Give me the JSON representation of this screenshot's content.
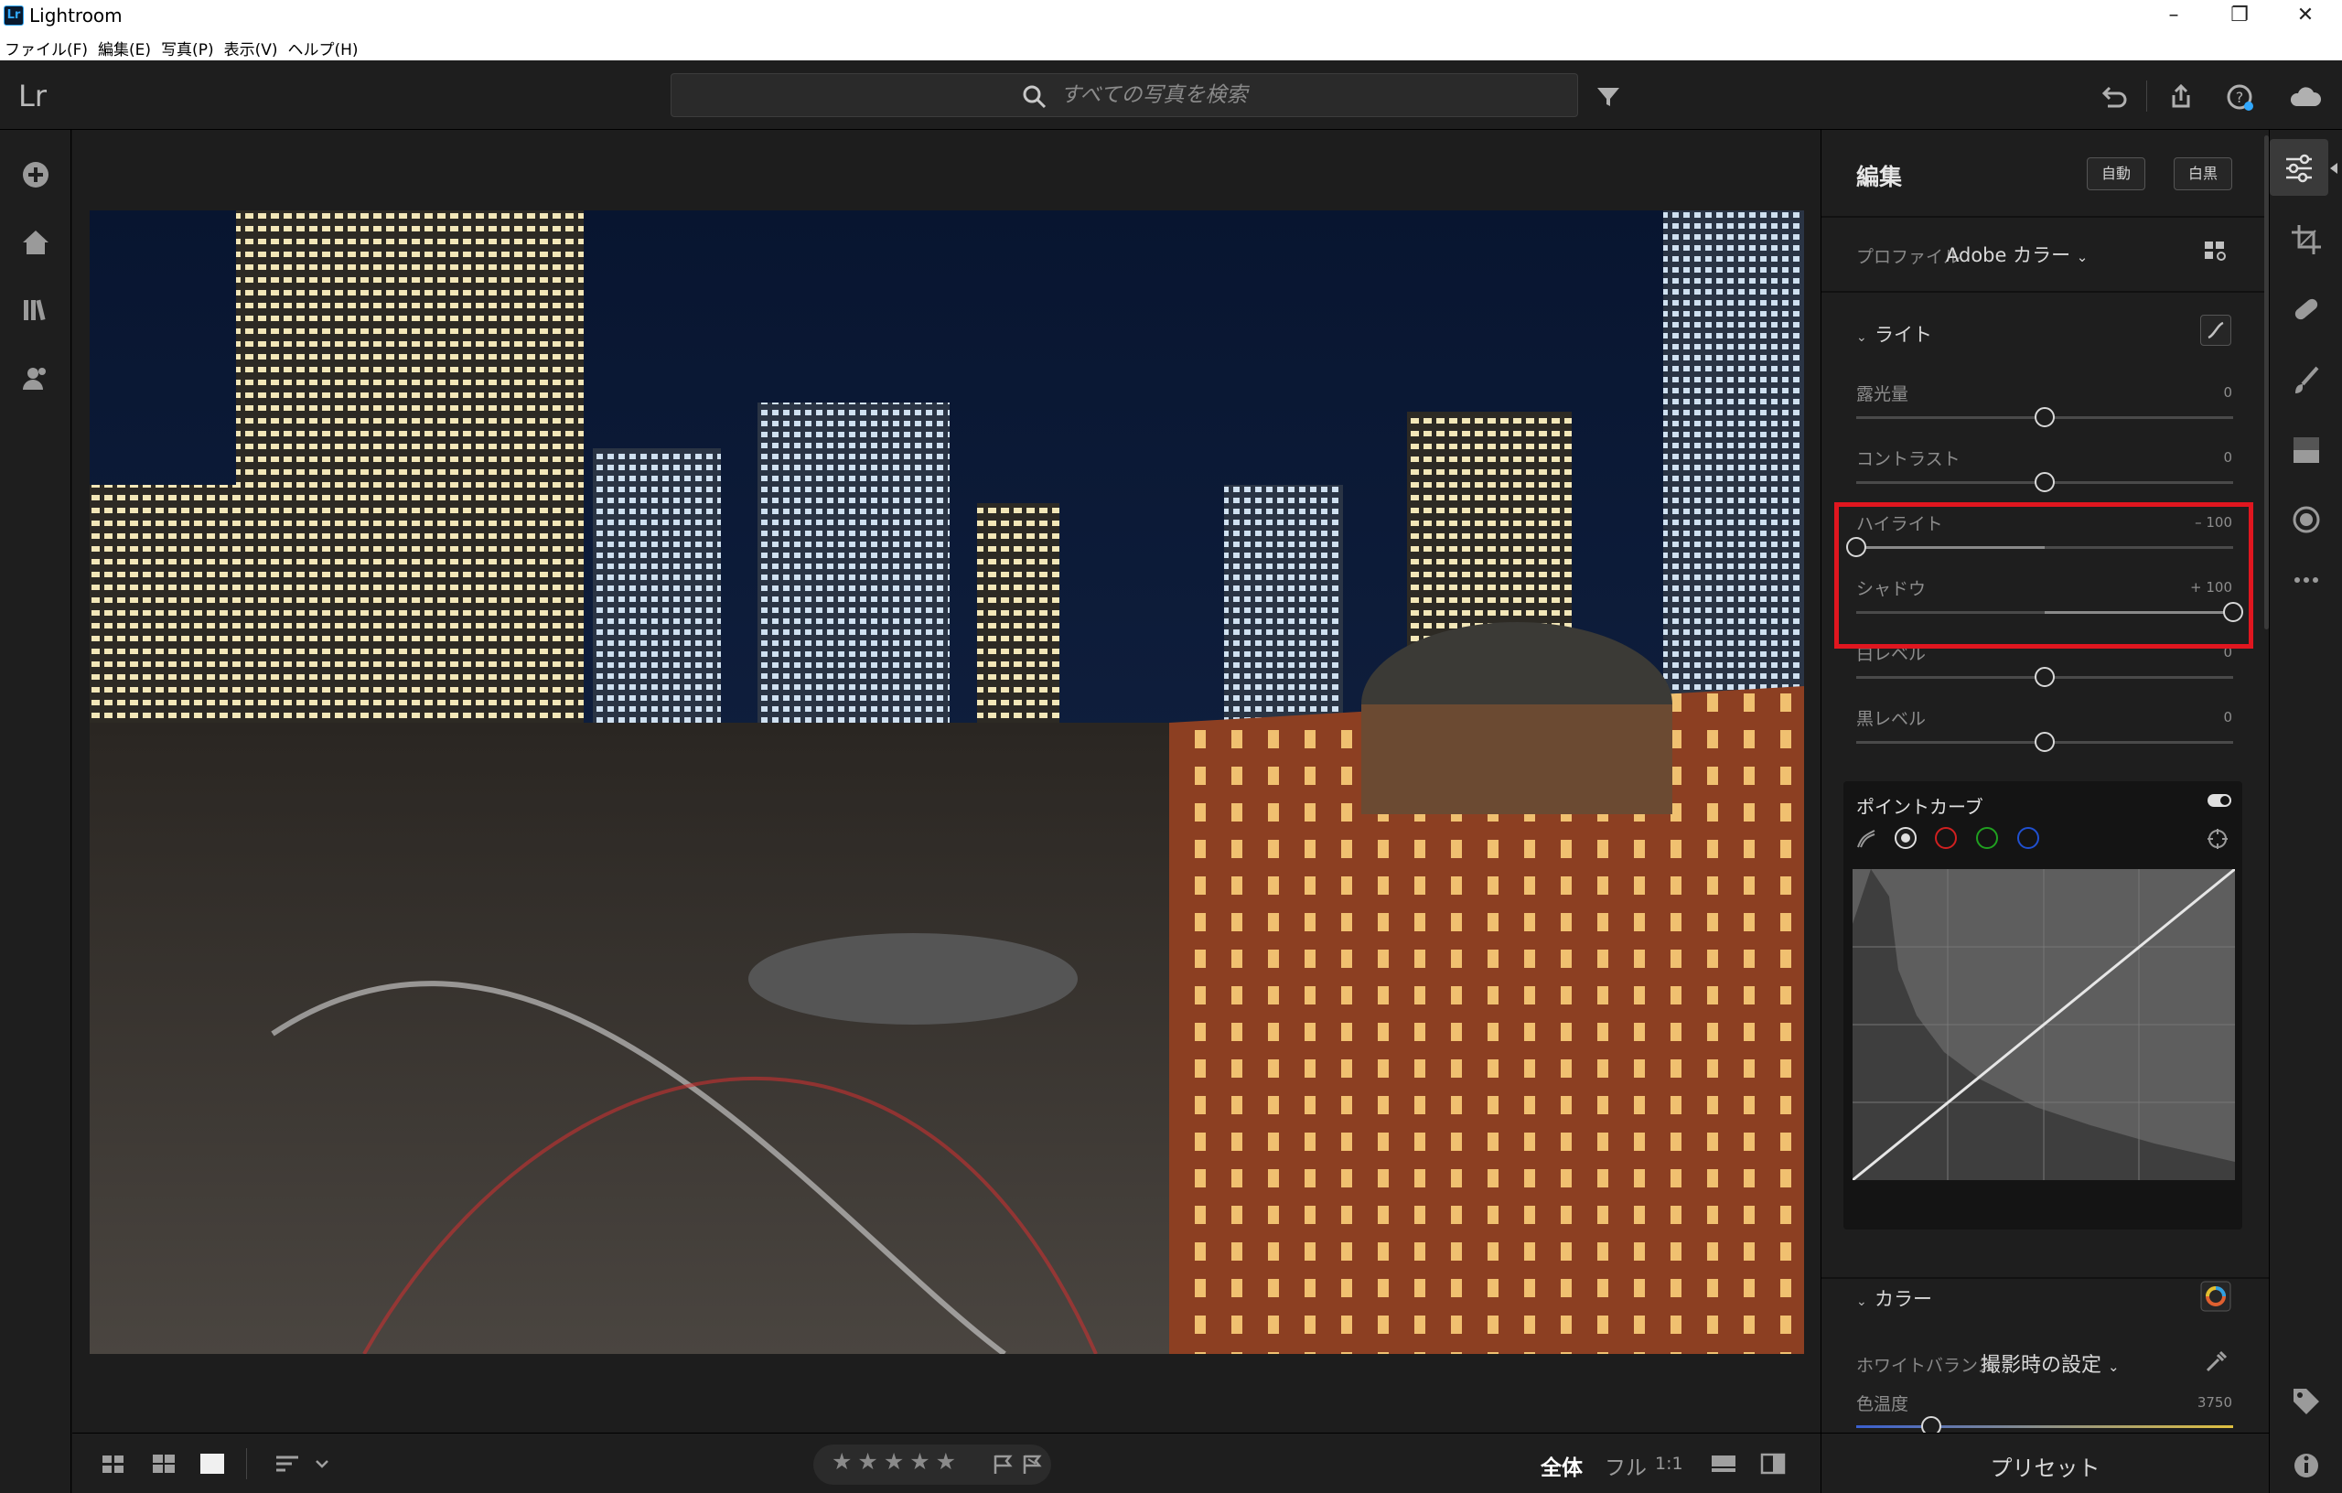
{
  "window": {
    "app_title": "Lightroom",
    "logo_text": "Lr"
  },
  "menu": [
    "ファイル(F)",
    "編集(E)",
    "写真(P)",
    "表示(V)",
    "ヘルプ(H)"
  ],
  "topbar": {
    "app_mark": "Lr",
    "search_placeholder": "すべての写真を検索"
  },
  "edit": {
    "title": "編集",
    "auto_label": "自動",
    "bw_label": "白黒",
    "profile_label": "プロファイル",
    "profile_value": "Adobe カラー",
    "light_section": "ライト",
    "sliders": [
      {
        "label": "露光量",
        "value": "0",
        "pos": 0.5
      },
      {
        "label": "コントラスト",
        "value": "0",
        "pos": 0.5
      },
      {
        "label": "ハイライト",
        "value": "– 100",
        "pos": 0.0
      },
      {
        "label": "シャドウ",
        "value": "+ 100",
        "pos": 1.0
      },
      {
        "label": "白レベル",
        "value": "0",
        "pos": 0.5
      },
      {
        "label": "黒レベル",
        "value": "0",
        "pos": 0.5
      }
    ],
    "point_curve": "ポイントカーブ",
    "color_section": "カラー",
    "wb_label": "ホワイトバランス",
    "wb_value": "撮影時の設定",
    "temp_label": "色温度",
    "temp_value": "3750",
    "temp_pos": 0.2
  },
  "preset_label": "プリセット",
  "bottombar": {
    "stars": "★★★★★",
    "view_fit": "全体",
    "view_full": "フル",
    "view_1to1": "1:1"
  },
  "colors": {
    "highlight_box": "#e0161f",
    "accent": "#31a8ff"
  }
}
